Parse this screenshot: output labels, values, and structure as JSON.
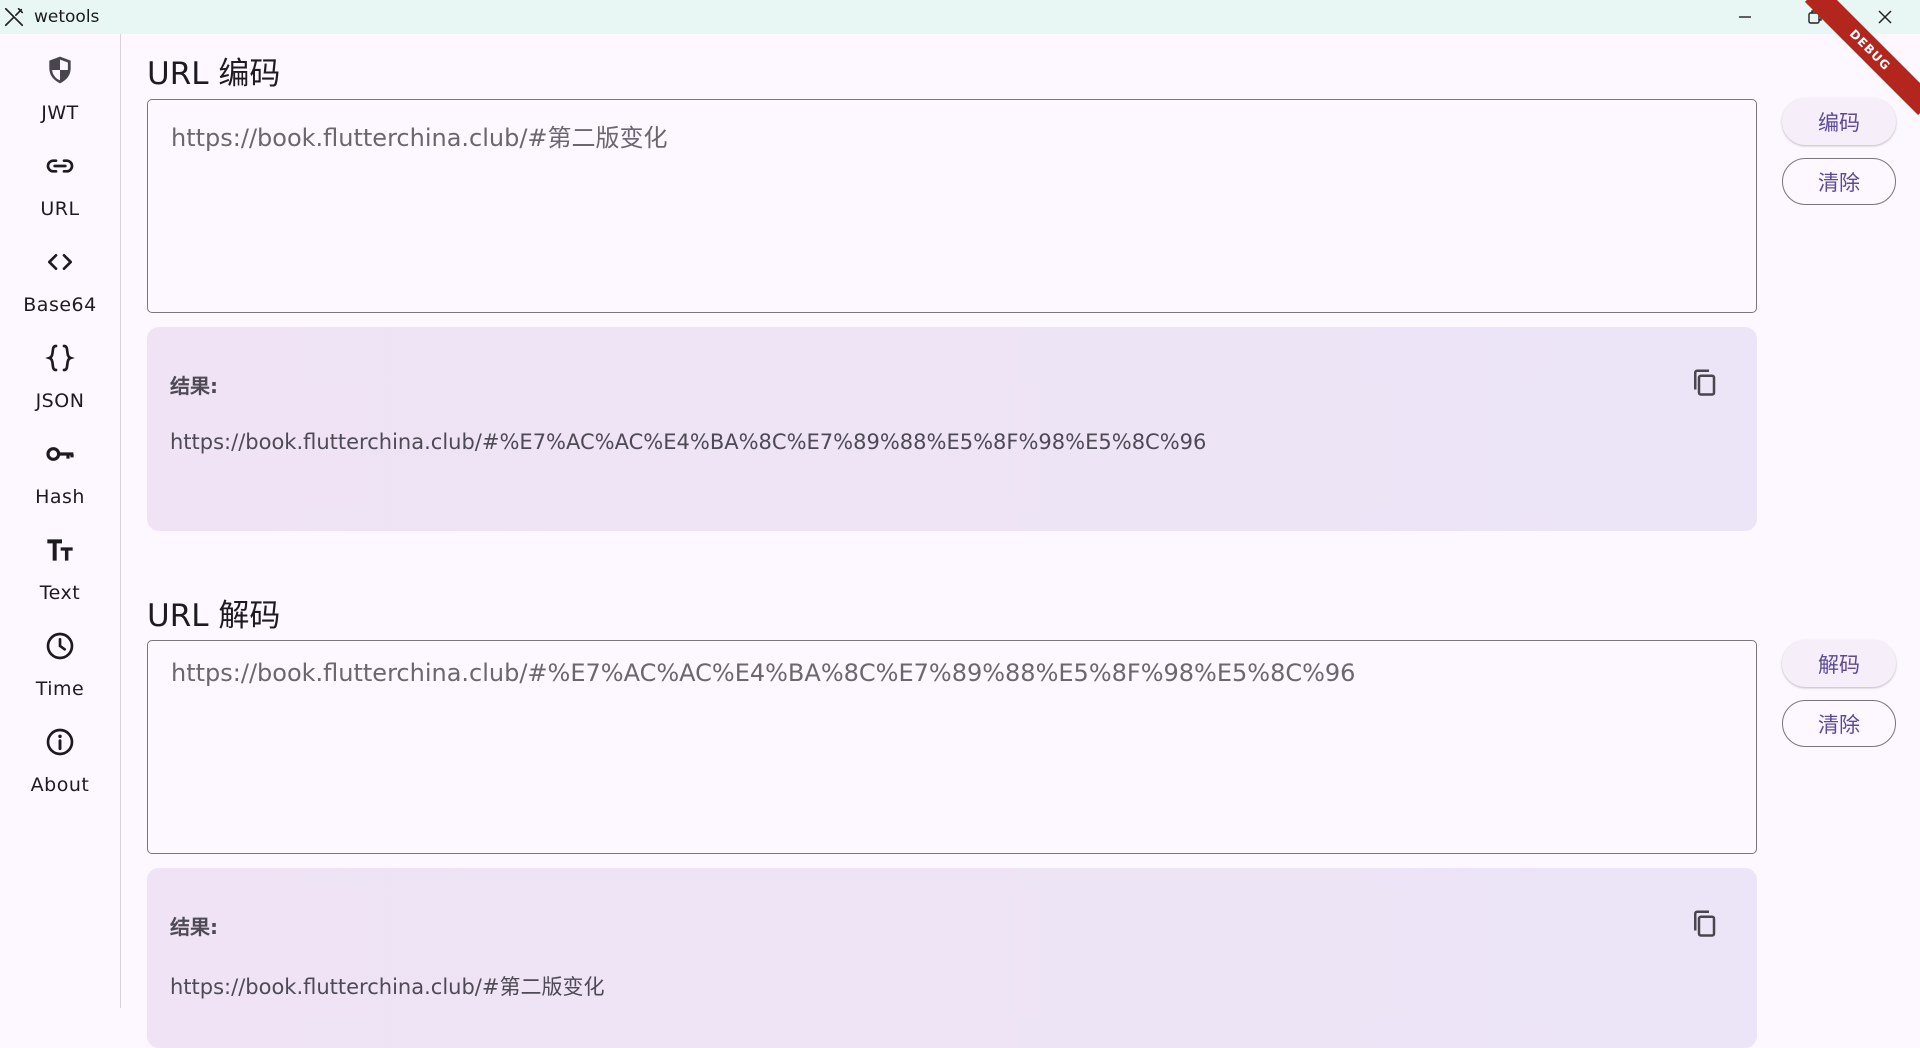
{
  "window": {
    "title": "wetools",
    "icons": {
      "app": "tools-icon",
      "minimize": "minimize-icon",
      "restore": "restore-icon",
      "close": "close-icon"
    }
  },
  "sidebar": {
    "items": [
      {
        "label": "JWT",
        "icon": "shield-icon",
        "selected": false
      },
      {
        "label": "URL",
        "icon": "link-icon",
        "selected": true
      },
      {
        "label": "Base64",
        "icon": "code-icon",
        "selected": false
      },
      {
        "label": "JSON",
        "icon": "braces-icon",
        "selected": false
      },
      {
        "label": "Hash",
        "icon": "key-icon",
        "selected": false
      },
      {
        "label": "Text",
        "icon": "text-fields-icon",
        "selected": false
      },
      {
        "label": "Time",
        "icon": "clock-icon",
        "selected": false
      },
      {
        "label": "About",
        "icon": "info-icon",
        "selected": false
      }
    ]
  },
  "encode": {
    "title": "URL 编码",
    "input_value": "https://book.flutterchina.club/#第二版变化",
    "action_label": "编码",
    "clear_label": "清除",
    "result_label": "结果:",
    "result_value": "https://book.flutterchina.club/#%E7%AC%AC%E4%BA%8C%E7%89%88%E5%8F%98%E5%8C%96"
  },
  "decode": {
    "title": "URL 解码",
    "input_value": "https://book.flutterchina.club/#%E7%AC%AC%E4%BA%8C%E7%89%88%E5%8F%98%E5%8C%96",
    "action_label": "解码",
    "clear_label": "清除",
    "result_label": "结果:",
    "result_value": "https://book.flutterchina.club/#第二版变化"
  },
  "debug_banner": "DEBUG",
  "colors": {
    "accent": "#e8ddff",
    "button_text": "#5a4a9a",
    "banner": "#b3261e",
    "titlebar": "#e8f7f4"
  }
}
